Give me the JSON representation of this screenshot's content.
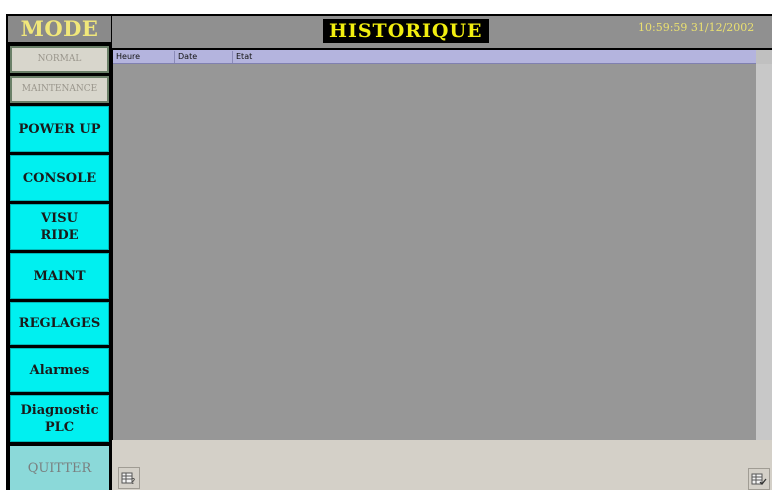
{
  "window": {
    "title": "HISTORIQUE",
    "clock": "10:59:59 31/12/2002"
  },
  "mode": {
    "title": "MODE",
    "normal_label": "NORMAL",
    "maintenance_label": "MAINTENANCE"
  },
  "nav": {
    "items": [
      {
        "label": "POWER UP"
      },
      {
        "label": "CONSOLE"
      },
      {
        "label": "VISU\nRIDE"
      },
      {
        "label": "MAINT"
      },
      {
        "label": "REGLAGES"
      },
      {
        "label": "Alarmes"
      },
      {
        "label": "Diagnostic\nPLC"
      }
    ],
    "quit_label": "QUITTER"
  },
  "table": {
    "columns": [
      "Heure",
      "Date",
      "Etat"
    ],
    "rows": []
  },
  "icons": {
    "left": "table-help-icon",
    "right": "table-check-icon"
  },
  "colors": {
    "nav_button": "#00f0f0",
    "title_text": "#f2ee10",
    "header_bg": "#b4b4de"
  }
}
